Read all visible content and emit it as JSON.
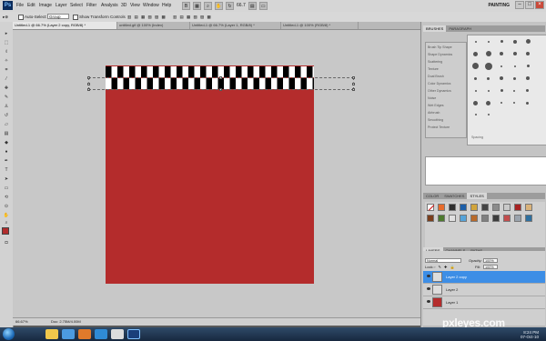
{
  "menubar": {
    "logo": "Ps",
    "items": [
      "File",
      "Edit",
      "Image",
      "Layer",
      "Select",
      "Filter",
      "Analysis",
      "3D",
      "View",
      "Window",
      "Help"
    ],
    "zoom": "66.7",
    "workspace": "PAINTING"
  },
  "options": {
    "auto_select_label": "Auto-Select:",
    "auto_select_value": "Group",
    "transform_label": "Show Transform Controls"
  },
  "tabs": [
    {
      "label": "Untitled-1 @ 66.7% (Layer 2 copy, RGB/8) *",
      "active": true
    },
    {
      "label": "untitled.gif @ 100% (Index)",
      "active": false
    },
    {
      "label": "Untitled-1 @ 66.7% (Layer 1, RGB/8) *",
      "active": false
    },
    {
      "label": "Untitled-1 @ 100% (RGB/8) *",
      "active": false
    }
  ],
  "status": {
    "zoom": "66.67%",
    "doc": "Doc: 2.75M/4.00M"
  },
  "brushes": {
    "tabs": [
      "BRUSHES",
      "PARAGRAPH"
    ],
    "items": [
      "Brush Tip Shape",
      "Shape Dynamics",
      "Scattering",
      "Texture",
      "Dual Brush",
      "Color Dynamics",
      "Other Dynamics",
      "Noise",
      "Wet Edges",
      "Airbrush",
      "Smoothing",
      "Protect Texture"
    ],
    "spacing_label": "Spacing"
  },
  "styles": {
    "tabs": [
      "COLOR",
      "SWATCHES",
      "STYLES"
    ],
    "colors": [
      "#d8d8d8",
      "#e76b2b",
      "#2f2f2f",
      "#1c5ea8",
      "#d1a43b",
      "#444444",
      "#8c8c8c",
      "#c9c9c9",
      "#a72222",
      "#d9b27a",
      "#7a3e1c",
      "#4c7a2e",
      "#e0e0e0",
      "#55a3d9",
      "#b86a2a",
      "#7f7f7f",
      "#3c3c3c",
      "#c24c4c",
      "#9aa3ad",
      "#2d6f9f"
    ]
  },
  "layers": {
    "tabs": [
      "LAYERS",
      "CHANNELS",
      "PATHS"
    ],
    "blend_mode": "Normal",
    "opacity_label": "Opacity:",
    "opacity": "100%",
    "lock_label": "Lock:",
    "fill_label": "Fill:",
    "fill": "100%",
    "items": [
      {
        "name": "Layer 2 copy",
        "selected": true,
        "thumb": "#dddddd"
      },
      {
        "name": "Layer 2",
        "selected": false,
        "thumb": "#dddddd"
      },
      {
        "name": "Layer 1",
        "selected": false,
        "thumb": "#b42c2c"
      }
    ]
  },
  "canvas": {
    "fill_color": "#b42c2c",
    "background": "#c8c8c8"
  },
  "watermark": {
    "text1": "pxleyes",
    "text2": ".com"
  },
  "taskbar": {
    "time": "8:24 PM",
    "date": "07-Oct-10"
  }
}
